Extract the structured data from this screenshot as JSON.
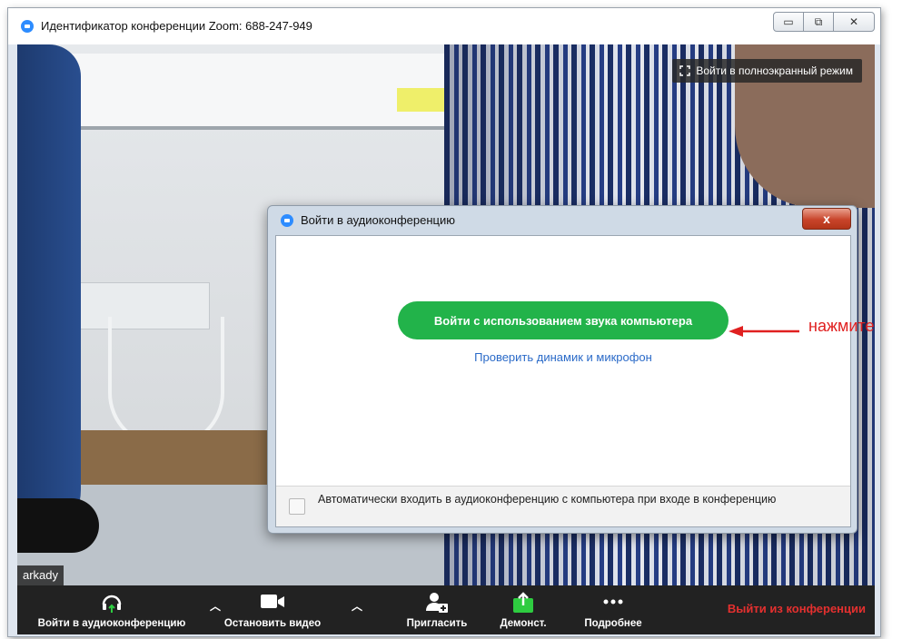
{
  "window": {
    "title": "Идентификатор конференции Zoom: 688-247-949",
    "controls": {
      "minimize": "▭",
      "restore": "⧉",
      "close": "✕"
    }
  },
  "video": {
    "fullscreen_label": "Войти в полноэкранный режим",
    "participant_name": "arkady"
  },
  "dialog": {
    "title": "Войти в аудиоконференцию",
    "close_symbol": "x",
    "join_button": "Войти с использованием звука компьютера",
    "test_link": "Проверить динамик и микрофон",
    "auto_join_label": "Автоматически входить в аудиоконференцию с компьютера при входе в конференцию",
    "auto_join_checked": false
  },
  "annotation": {
    "text": "нажмите",
    "color": "#e02020"
  },
  "toolbar": {
    "join_audio": "Войти в аудиоконференцию",
    "stop_video": "Остановить видео",
    "invite": "Пригласить",
    "share": "Демонст.",
    "more": "Подробнее",
    "leave": "Выйти из конференции"
  },
  "colors": {
    "accent_green": "#22b34a",
    "link_blue": "#2a6ac8",
    "leave_red": "#e5302f",
    "toolbar_bg": "#222222",
    "zoom_blue": "#2d8cff"
  }
}
